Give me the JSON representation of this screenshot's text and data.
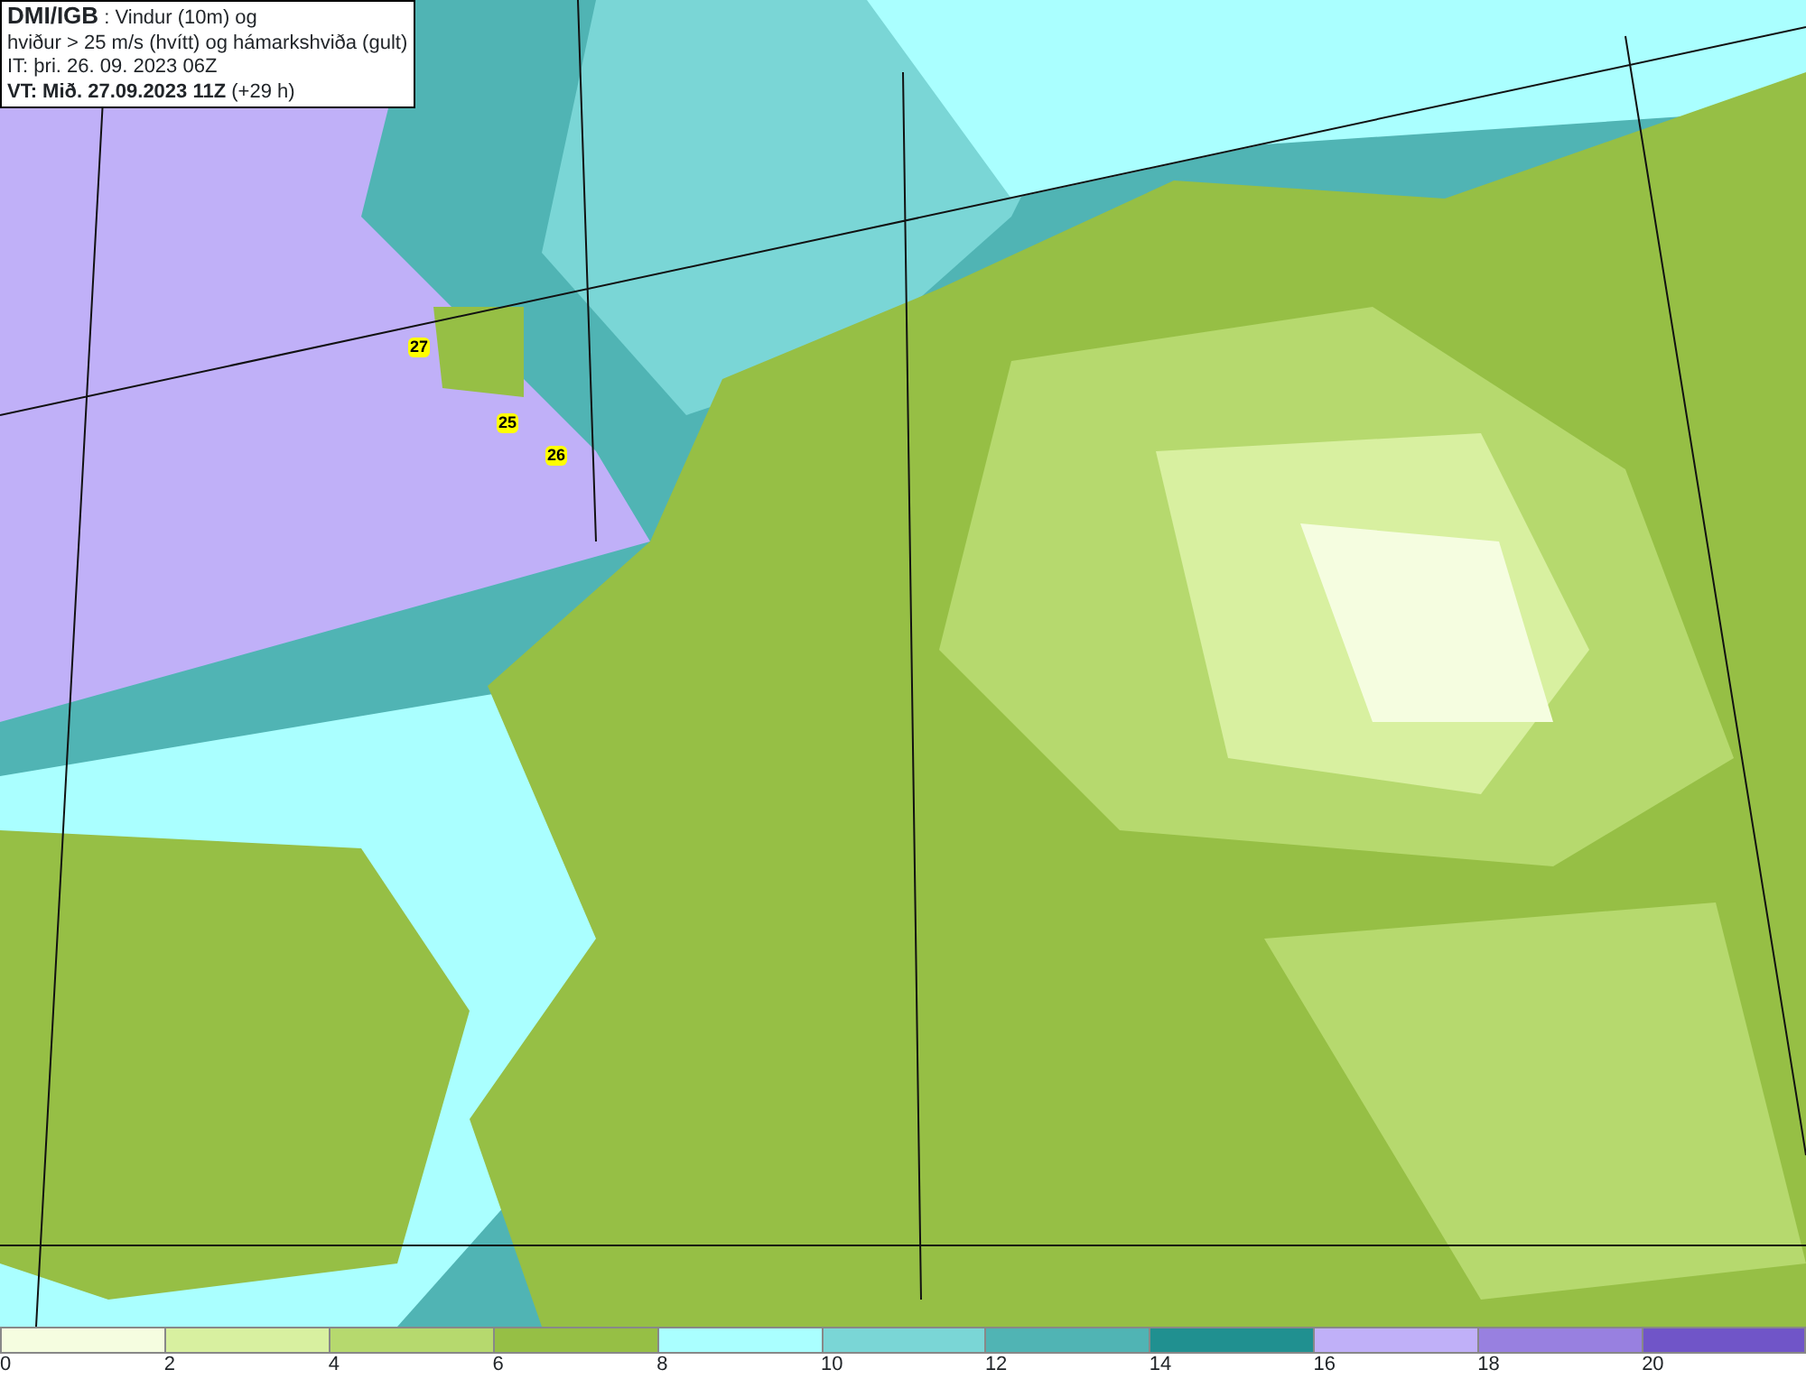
{
  "title_box": {
    "lines": [
      "**DMI/IGB** : Vindur (10m) og",
      "hviður > 25 m/s (hvítt) og hámarkshviða (gult)",
      "IT: þri. 26. 09. 2023 06Z",
      "**VT: Mið. 27.09.2023 11Z** (+29 h)"
    ]
  },
  "map": {
    "gust_markers": [
      {
        "value": "27"
      },
      {
        "value": "25"
      },
      {
        "value": "26"
      }
    ]
  },
  "legend": {
    "bins": [
      {
        "label": "0",
        "color": "#f5fde0"
      },
      {
        "label": "2",
        "color": "#d8f0a0"
      },
      {
        "label": "4",
        "color": "#b6d96e"
      },
      {
        "label": "6",
        "color": "#96bf45"
      },
      {
        "label": "8",
        "color": "#aaffff"
      },
      {
        "label": "10",
        "color": "#7ad6d6"
      },
      {
        "label": "12",
        "color": "#50b4b4"
      },
      {
        "label": "14",
        "color": "#209090"
      },
      {
        "label": "16",
        "color": "#c0b0f8"
      },
      {
        "label": "18",
        "color": "#9880e0"
      },
      {
        "label": "20",
        "color": "#7055c8"
      }
    ]
  }
}
